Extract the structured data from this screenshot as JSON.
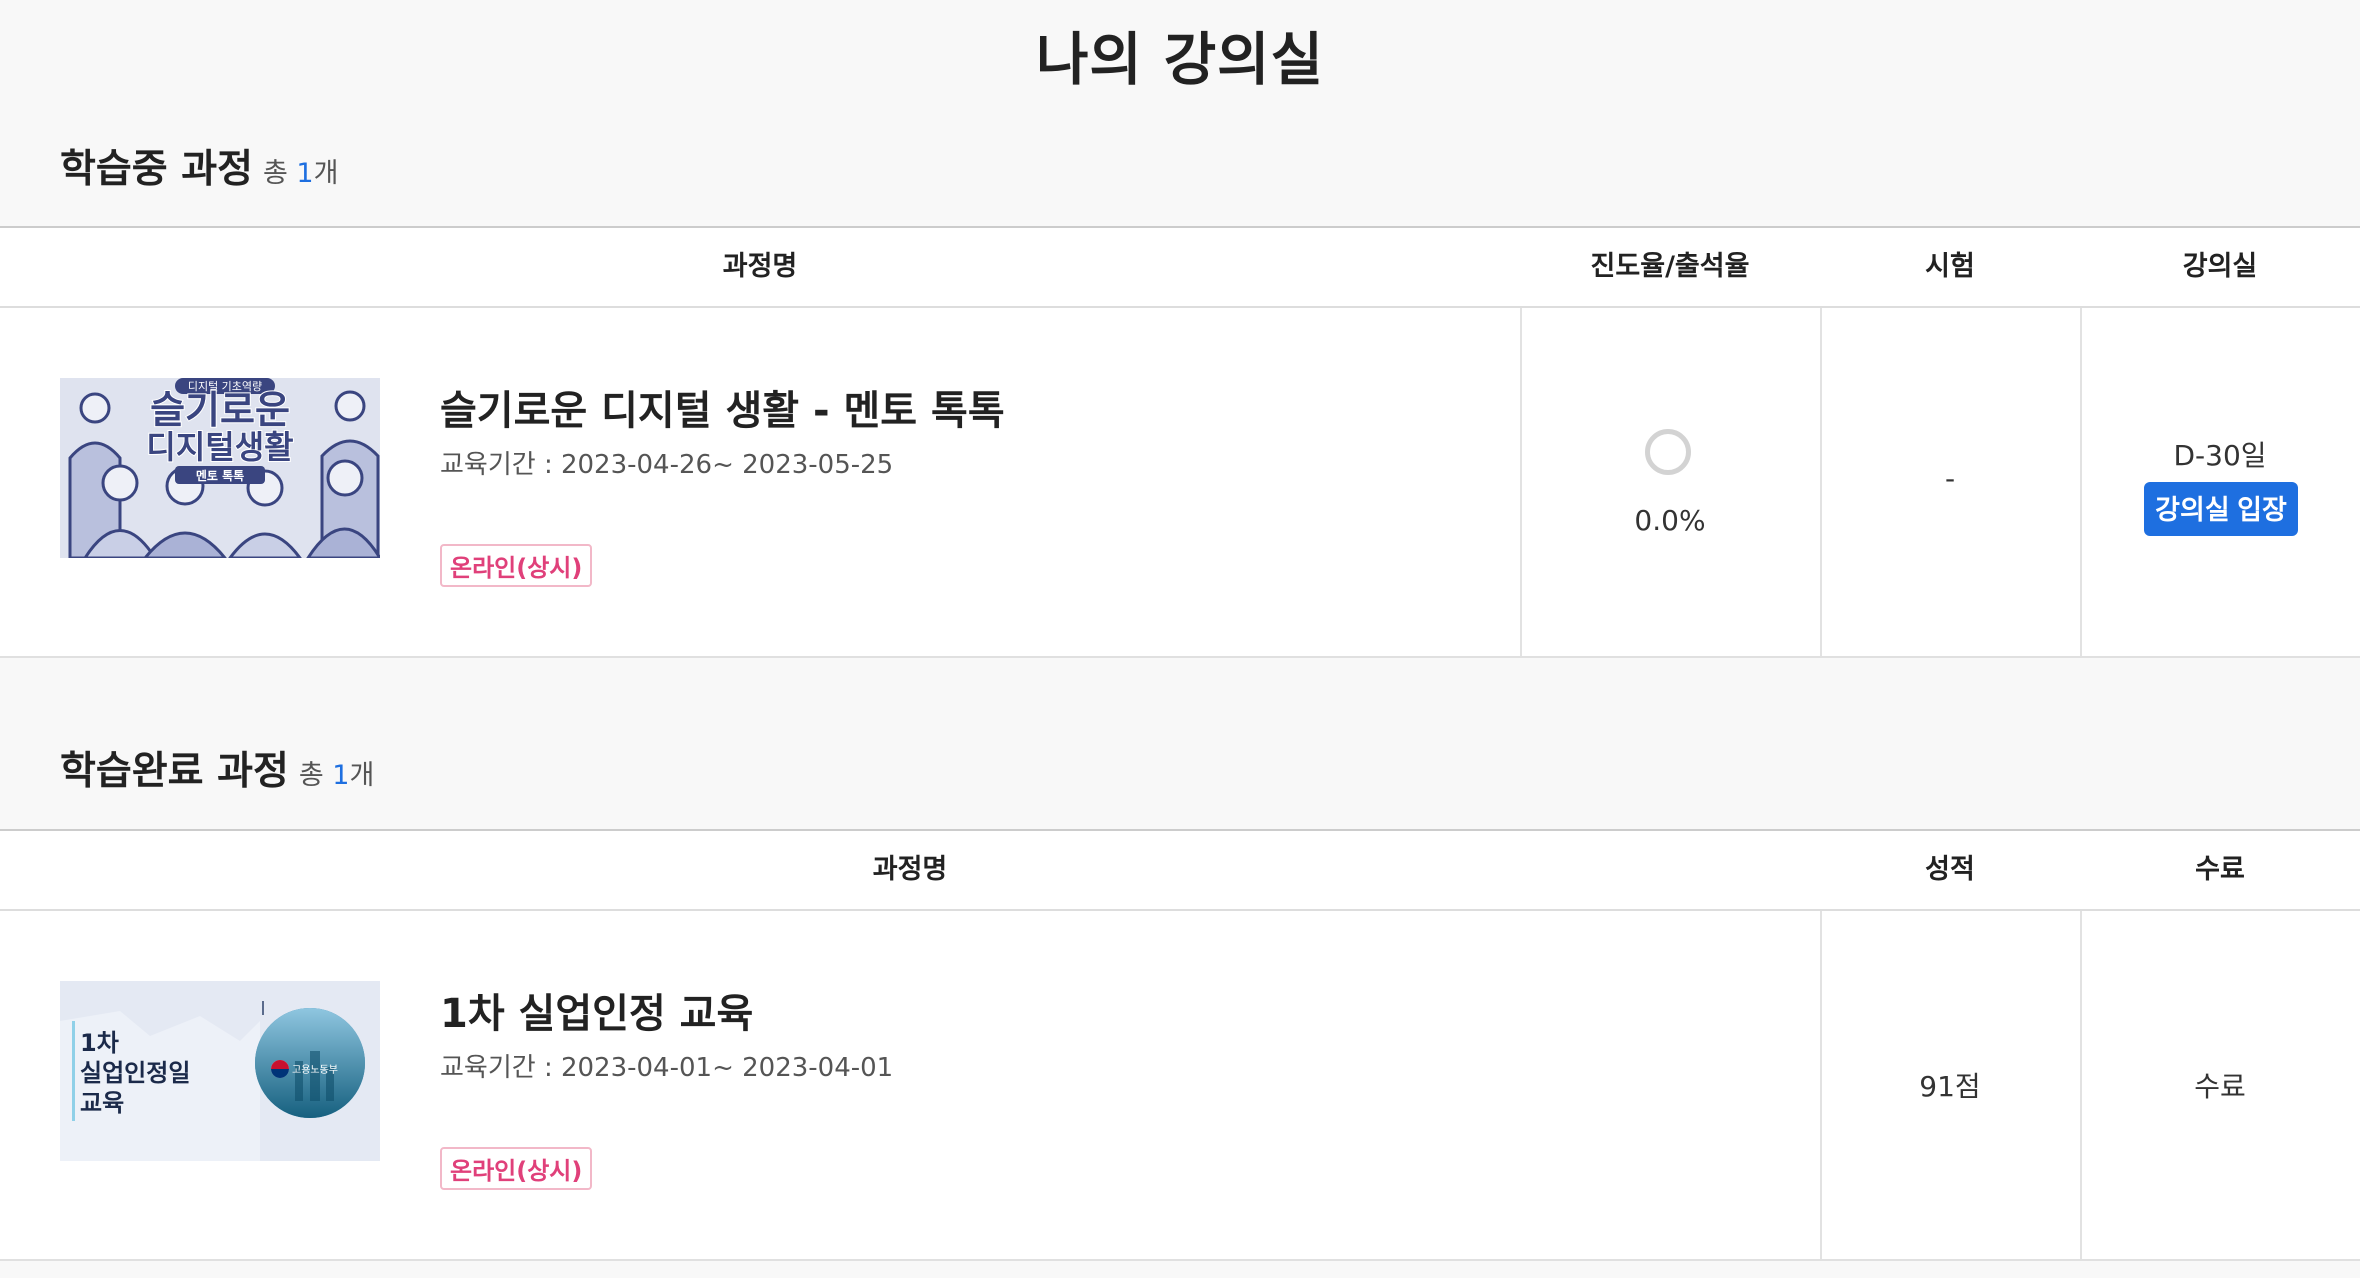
{
  "page": {
    "title": "나의 강의실"
  },
  "in_progress": {
    "title": "학습중 과정",
    "count_prefix": "총 ",
    "count": "1",
    "count_suffix": "개",
    "headers": {
      "course": "과정명",
      "progress": "진도율/출석율",
      "exam": "시험",
      "room": "강의실"
    },
    "course": {
      "thumb_tag": "디지털 기초역량",
      "thumb_title_1": "슬기로운",
      "thumb_title_2": "디지털생활",
      "thumb_sub": "멘토 톡톡",
      "title": "슬기로운 디지털 생활 - 멘토 톡톡",
      "period": "교육기간 : 2023-04-26~ 2023-05-25",
      "badge": "온라인(상시)",
      "progress_text": "0.0%",
      "progress_value": 0.0,
      "exam": "-",
      "dday": "D-30일",
      "enter_label": "강의실 입장"
    }
  },
  "completed": {
    "title": "학습완료 과정",
    "count_prefix": "총 ",
    "count": "1",
    "count_suffix": "개",
    "headers": {
      "course": "과정명",
      "grade": "성적",
      "completion": "수료"
    },
    "course": {
      "thumb_line_1": "1차",
      "thumb_line_2": "실업인정일",
      "thumb_line_3": "교육",
      "thumb_logo": "고용노동부",
      "title": "1차 실업인정 교육",
      "period": "교육기간 : 2023-04-01~ 2023-04-01",
      "badge": "온라인(상시)",
      "grade": "91점",
      "completion": "수료"
    }
  },
  "colors": {
    "accent": "#1e6fe0",
    "badge": "#e0407a",
    "badge_border": "#f2b8c8"
  }
}
